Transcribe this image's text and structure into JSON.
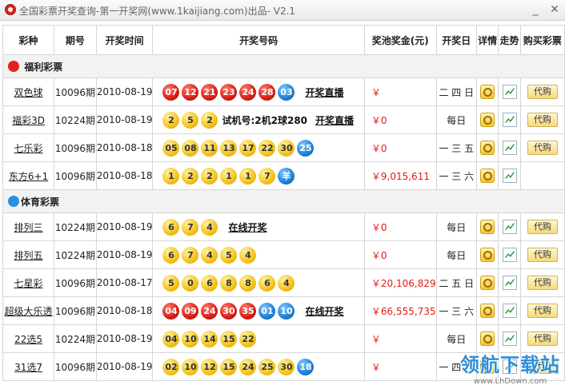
{
  "window": {
    "title": "全国彩票开奖查询-第一开奖网(www.1kaijiang.com)出品- V2.1",
    "minimize": "_",
    "close": "✕"
  },
  "columns": [
    "彩种",
    "期号",
    "开奖时间",
    "开奖号码",
    "奖池奖金(元)",
    "开奖日",
    "详情",
    "走势",
    "购买彩票"
  ],
  "categories": {
    "welfare": "福利彩票",
    "sports": "体育彩票"
  },
  "rows": [
    {
      "name": "双色球",
      "issue": "10096期",
      "date": "2010-08-19",
      "balls": [
        {
          "n": "07",
          "c": "red"
        },
        {
          "n": "12",
          "c": "red"
        },
        {
          "n": "21",
          "c": "red"
        },
        {
          "n": "23",
          "c": "red"
        },
        {
          "n": "24",
          "c": "red"
        },
        {
          "n": "28",
          "c": "red"
        },
        {
          "n": "03",
          "c": "blue"
        }
      ],
      "extra": "",
      "link": "开奖直播",
      "jackpot": "￥",
      "days": "二 四 日",
      "detail": true,
      "trend": true,
      "buy": "代购"
    },
    {
      "name": "福彩3D",
      "issue": "10224期",
      "date": "2010-08-19",
      "balls": [
        {
          "n": "2",
          "c": "yellow"
        },
        {
          "n": "5",
          "c": "yellow"
        },
        {
          "n": "2",
          "c": "yellow"
        }
      ],
      "extra": "试机号:2机2球280",
      "link": "开奖直播",
      "jackpot": "￥0",
      "days": "每日",
      "detail": true,
      "trend": true,
      "buy": "代购"
    },
    {
      "name": "七乐彩",
      "issue": "10096期",
      "date": "2010-08-18",
      "balls": [
        {
          "n": "05",
          "c": "yellow"
        },
        {
          "n": "08",
          "c": "yellow"
        },
        {
          "n": "11",
          "c": "yellow"
        },
        {
          "n": "13",
          "c": "yellow"
        },
        {
          "n": "17",
          "c": "yellow"
        },
        {
          "n": "22",
          "c": "yellow"
        },
        {
          "n": "30",
          "c": "yellow"
        },
        {
          "n": "25",
          "c": "blue"
        }
      ],
      "extra": "",
      "link": "",
      "jackpot": "￥0",
      "days": "一 三 五",
      "detail": true,
      "trend": true,
      "buy": "代购"
    },
    {
      "name": "东方6+1",
      "issue": "10096期",
      "date": "2010-08-18",
      "balls": [
        {
          "n": "1",
          "c": "yellow"
        },
        {
          "n": "2",
          "c": "yellow"
        },
        {
          "n": "2",
          "c": "yellow"
        },
        {
          "n": "1",
          "c": "yellow"
        },
        {
          "n": "1",
          "c": "yellow"
        },
        {
          "n": "7",
          "c": "yellow"
        },
        {
          "n": "羊",
          "c": "blue"
        }
      ],
      "extra": "",
      "link": "",
      "jackpot": "￥9,015,611",
      "days": "一 三 六",
      "detail": true,
      "trend": true,
      "buy": ""
    },
    {
      "category": "sports"
    },
    {
      "name": "排列三",
      "issue": "10224期",
      "date": "2010-08-19",
      "balls": [
        {
          "n": "6",
          "c": "yellow"
        },
        {
          "n": "7",
          "c": "yellow"
        },
        {
          "n": "4",
          "c": "yellow"
        }
      ],
      "extra": "",
      "link": "在线开奖",
      "jackpot": "￥0",
      "days": "每日",
      "detail": true,
      "trend": true,
      "buy": "代购"
    },
    {
      "name": "排列五",
      "issue": "10224期",
      "date": "2010-08-19",
      "balls": [
        {
          "n": "6",
          "c": "yellow"
        },
        {
          "n": "7",
          "c": "yellow"
        },
        {
          "n": "4",
          "c": "yellow"
        },
        {
          "n": "5",
          "c": "yellow"
        },
        {
          "n": "4",
          "c": "yellow"
        }
      ],
      "extra": "",
      "link": "",
      "jackpot": "￥0",
      "days": "每日",
      "detail": true,
      "trend": true,
      "buy": "代购"
    },
    {
      "name": "七星彩",
      "issue": "10096期",
      "date": "2010-08-17",
      "balls": [
        {
          "n": "5",
          "c": "yellow"
        },
        {
          "n": "0",
          "c": "yellow"
        },
        {
          "n": "6",
          "c": "yellow"
        },
        {
          "n": "8",
          "c": "yellow"
        },
        {
          "n": "8",
          "c": "yellow"
        },
        {
          "n": "6",
          "c": "yellow"
        },
        {
          "n": "4",
          "c": "yellow"
        }
      ],
      "extra": "",
      "link": "",
      "jackpot": "￥20,106,829",
      "days": "二 五 日",
      "detail": true,
      "trend": true,
      "buy": "代购"
    },
    {
      "name": "超级大乐透",
      "issue": "10096期",
      "date": "2010-08-18",
      "balls": [
        {
          "n": "04",
          "c": "red"
        },
        {
          "n": "09",
          "c": "red"
        },
        {
          "n": "24",
          "c": "red"
        },
        {
          "n": "30",
          "c": "red"
        },
        {
          "n": "35",
          "c": "red"
        },
        {
          "n": "01",
          "c": "blue"
        },
        {
          "n": "10",
          "c": "blue"
        }
      ],
      "extra": "",
      "link": "在线开奖",
      "jackpot": "￥66,555,735",
      "days": "一 三 六",
      "detail": true,
      "trend": true,
      "buy": "代购"
    },
    {
      "name": "22选5",
      "issue": "10224期",
      "date": "2010-08-19",
      "balls": [
        {
          "n": "04",
          "c": "yellow"
        },
        {
          "n": "10",
          "c": "yellow"
        },
        {
          "n": "14",
          "c": "yellow"
        },
        {
          "n": "15",
          "c": "yellow"
        },
        {
          "n": "22",
          "c": "yellow"
        }
      ],
      "extra": "",
      "link": "",
      "jackpot": "￥",
      "days": "每日",
      "detail": true,
      "trend": true,
      "buy": "代购"
    },
    {
      "name": "31选7",
      "issue": "10096期",
      "date": "2010-08-19",
      "balls": [
        {
          "n": "02",
          "c": "yellow"
        },
        {
          "n": "10",
          "c": "yellow"
        },
        {
          "n": "12",
          "c": "yellow"
        },
        {
          "n": "15",
          "c": "yellow"
        },
        {
          "n": "24",
          "c": "yellow"
        },
        {
          "n": "25",
          "c": "yellow"
        },
        {
          "n": "30",
          "c": "yellow"
        },
        {
          "n": "18",
          "c": "blue"
        }
      ],
      "extra": "",
      "link": "",
      "jackpot": "￥",
      "days": "一 四 六",
      "detail": true,
      "trend": true,
      "buy": "代购"
    }
  ],
  "watermark": {
    "main": "领航下载站",
    "url": "www.LhDown.com"
  }
}
